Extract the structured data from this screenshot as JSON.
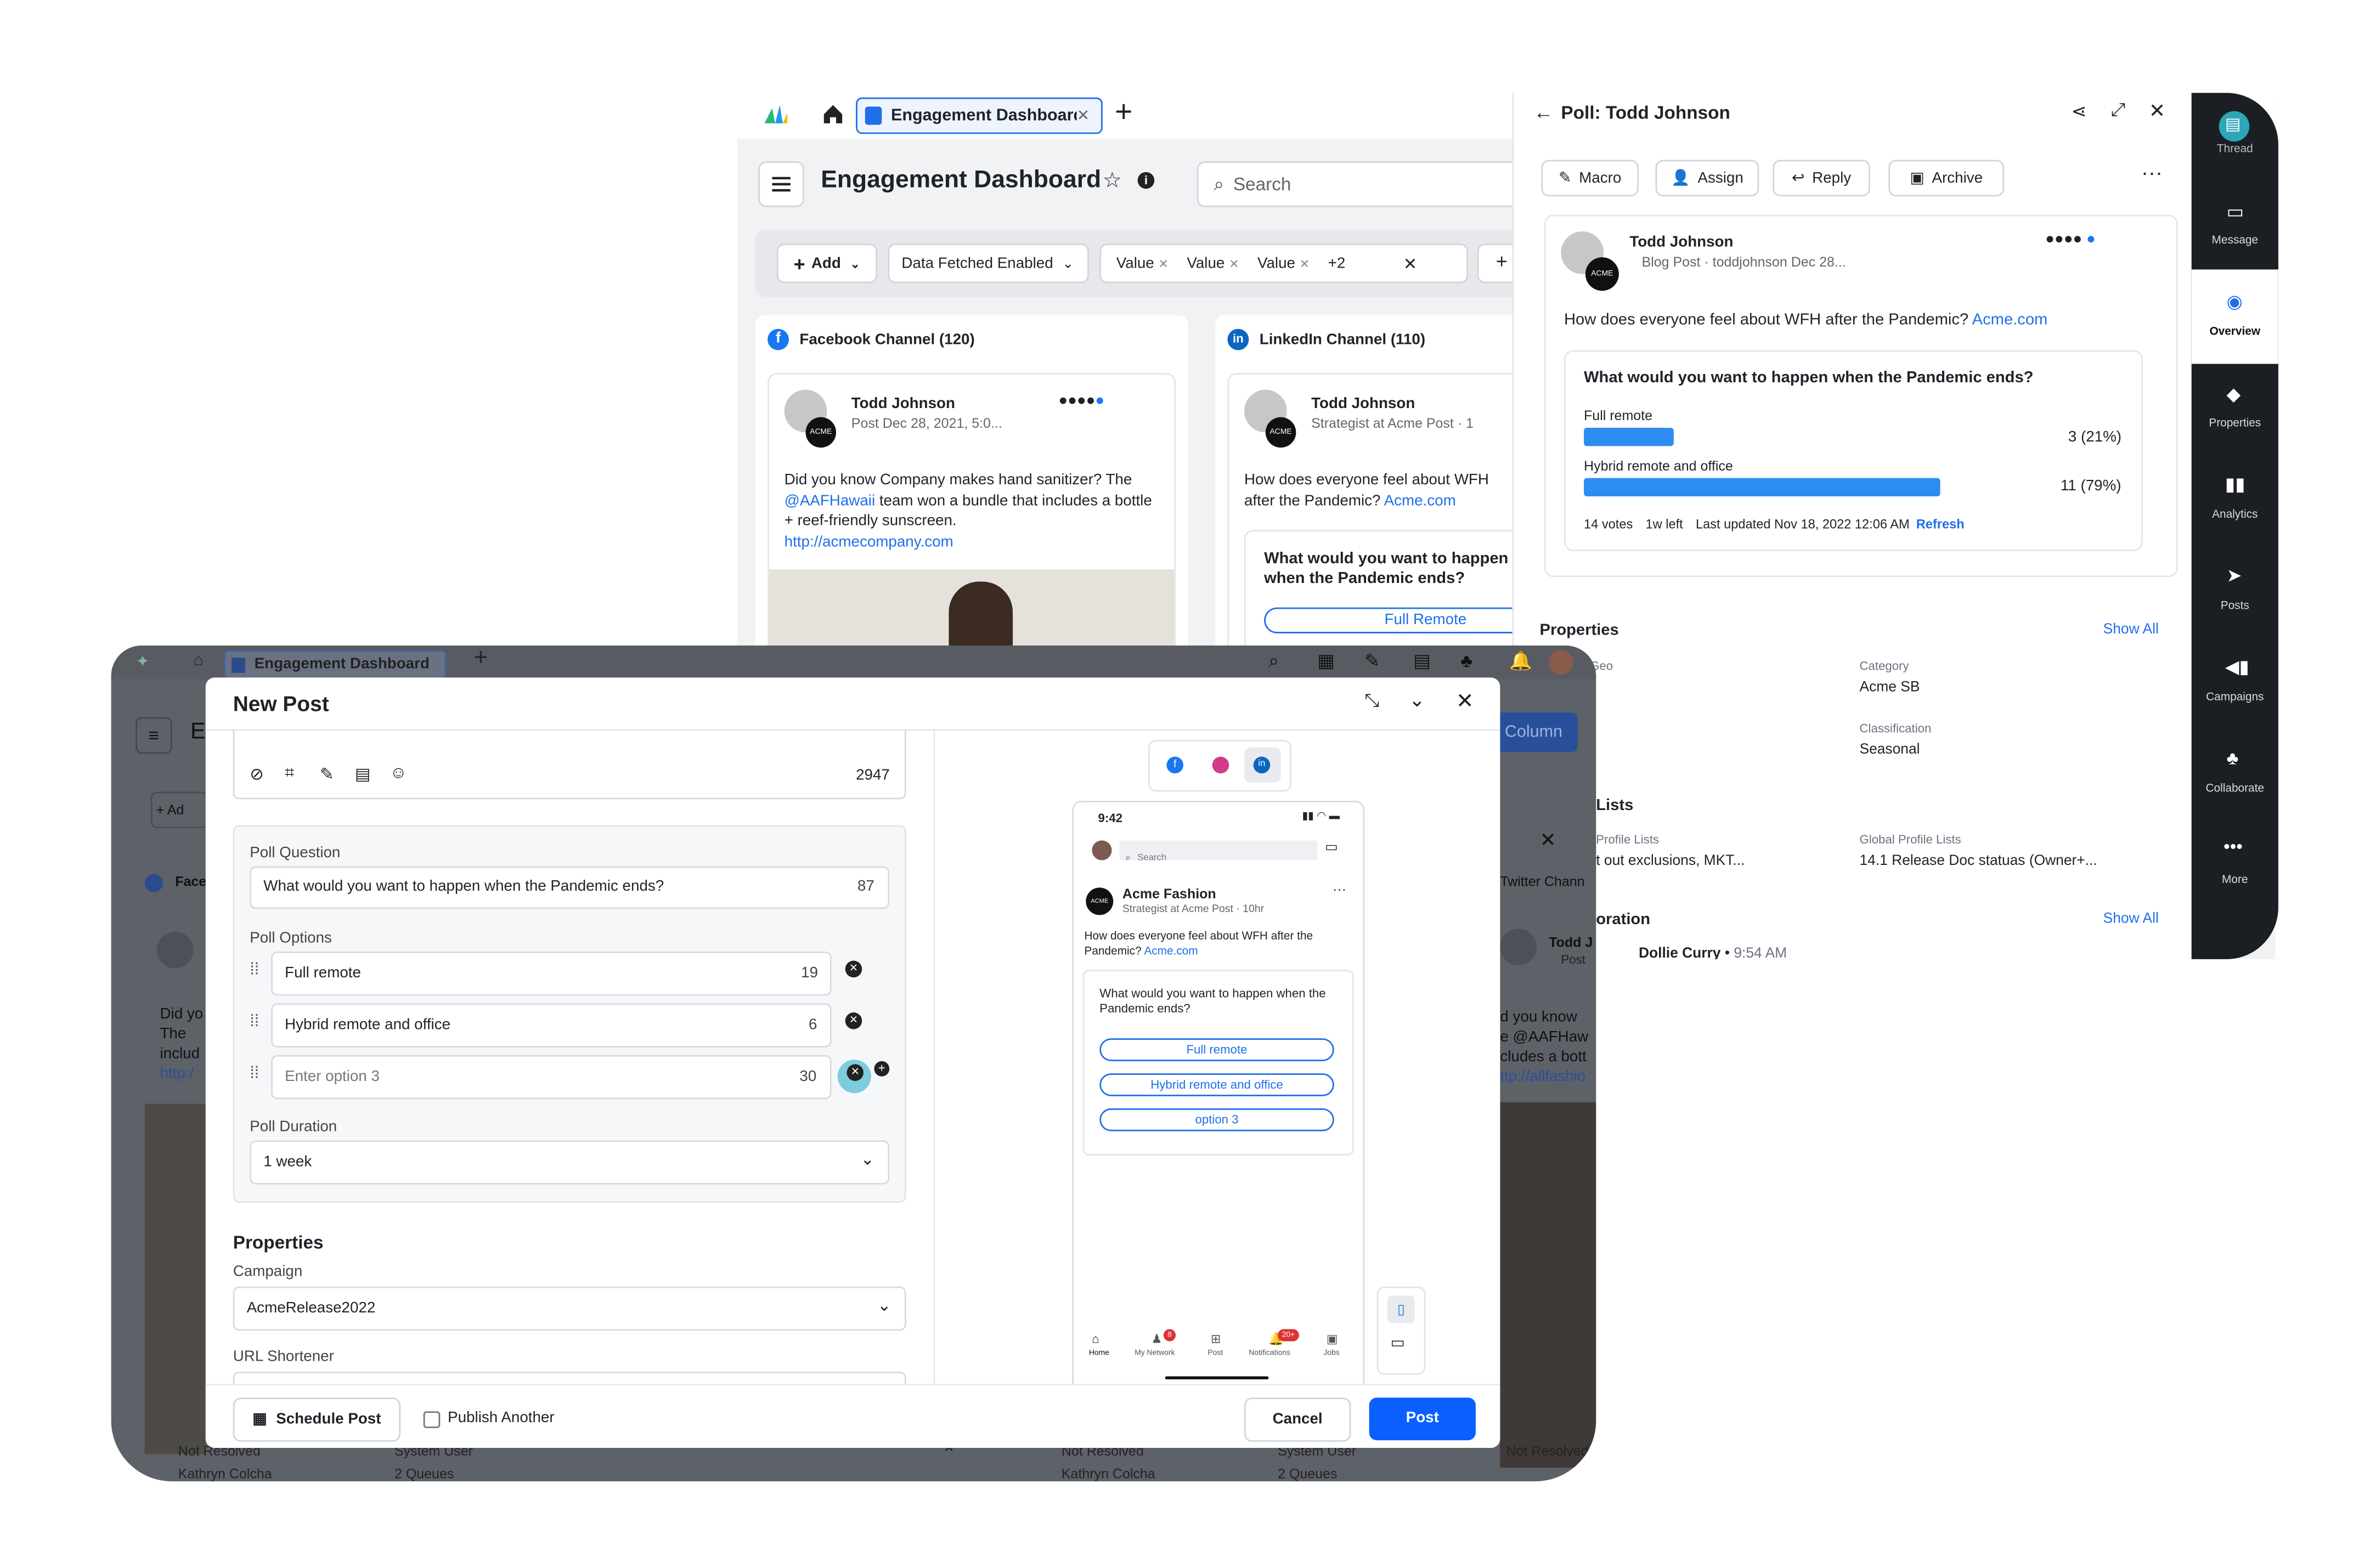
{
  "back_window": {
    "tab_title": "Engagement Dashboard",
    "page_title": "Engagement Dashboard",
    "search_placeholder": "Search",
    "filters": {
      "add_label": "Add",
      "data_fetched": "Data Fetched Enabled",
      "chips": [
        "Value",
        "Value",
        "Value"
      ],
      "more_chip": "+2"
    },
    "columns": [
      {
        "title": "Facebook Channel (120)"
      },
      {
        "title": "LinkedIn Channel (110)"
      }
    ],
    "fb_post": {
      "author": "Todd Johnson",
      "meta": "Post  Dec 28, 2021, 5:0...",
      "text_a": "Did you know Company makes hand sanitizer? The ",
      "mention": "@AAFHawaii",
      "text_b": " team won a bundle that includes a bottle + reef-friendly sunscreen.",
      "link": "http://acmecompany.com"
    },
    "li_post": {
      "author": "Todd Johnson",
      "meta": "Strategist at Acme  Post · 1",
      "text": "How does everyone feel about WFH after the Pandemic?",
      "link": "Acme.com",
      "poll_question": "What would you want to happen when the Pandemic ends?",
      "option": "Full Remote"
    }
  },
  "poll_panel": {
    "title": "Poll: Todd Johnson",
    "actions": [
      "Macro",
      "Assign",
      "Reply",
      "Archive"
    ],
    "author": "Todd Johnson",
    "meta": "Blog Post · toddjohnson Dec 28...",
    "text": "How does everyone feel about WFH after the Pandemic?",
    "link": "Acme.com",
    "question": "What would you want to happen when the Pandemic ends?",
    "options": [
      {
        "label": "Full remote",
        "result": "3 (21%)",
        "percent": 21
      },
      {
        "label": "Hybrid remote and office",
        "result": "11 (79%)",
        "percent": 79
      }
    ],
    "votes": "14 votes",
    "time_left": "1w left",
    "updated": "Last updated Nov 18, 2022 12:06 AM",
    "refresh": "Refresh",
    "properties_title": "Properties",
    "show_all": "Show All",
    "geo_label": "Geo",
    "category_label": "Category",
    "category_value": "Acme SB",
    "classification_label": "Classification",
    "classification_value": "Seasonal",
    "lists_title": "Lists",
    "profile_lists_label": "Profile Lists",
    "profile_lists_value": "t out exclusions, MKT...",
    "global_lists_label": "Global Profile Lists",
    "global_lists_value": "14.1 Release Doc statuas (Owner+...",
    "collab_title": "oration",
    "collab_person": "Dollie Curry",
    "collab_time": "9:54 AM"
  },
  "right_rail": [
    {
      "label": "Thread"
    },
    {
      "label": "Message"
    },
    {
      "label": "Overview"
    },
    {
      "label": "Properties"
    },
    {
      "label": "Analytics"
    },
    {
      "label": "Posts"
    },
    {
      "label": "Campaigns"
    },
    {
      "label": "Collaborate"
    },
    {
      "label": "More"
    }
  ],
  "front_window": {
    "tab_title": "Engagement Dashboard",
    "column_button": "Column",
    "bg_left_col": {
      "title": "Face",
      "add": "Ad",
      "text": [
        "Did yo",
        "The ",
        "includ",
        "http:/"
      ],
      "e_letter": "E"
    },
    "bg_right_col": {
      "title": "Twitter Chann",
      "author": "Todd J",
      "meta": "Post",
      "text": [
        "d you know ",
        "e @AAFHaw",
        "cludes a bott",
        "ttp://allfashio"
      ]
    },
    "bottom_status": {
      "not_resolved": "Not Resolved",
      "system_user": "System User",
      "kathryn": "Kathryn Colcha",
      "queues": "2 Queues"
    }
  },
  "new_post": {
    "title": "New Post",
    "char_count": "2947",
    "poll_question_label": "Poll Question",
    "poll_question_value": "What would you want to happen when the Pandemic ends?",
    "poll_question_count": "87",
    "poll_options_label": "Poll Options",
    "options": [
      {
        "value": "Full remote",
        "count": "19"
      },
      {
        "value": "Hybrid remote and office",
        "count": "6"
      }
    ],
    "option3_placeholder": "Enter option 3",
    "option3_count": "30",
    "duration_label": "Poll Duration",
    "duration_value": "1 week",
    "properties_title": "Properties",
    "campaign_label": "Campaign",
    "campaign_value": "AcmeRelease2022",
    "url_shortener_label": "URL Shortener",
    "schedule_btn": "Schedule Post",
    "publish_another": "Publish Another",
    "cancel_btn": "Cancel",
    "post_btn": "Post",
    "preview": {
      "time": "9:42",
      "search": "Search",
      "author": "Acme Fashion",
      "meta": "Strategist at Acme  Post · 10hr",
      "text": "How does everyone feel about WFH after the Pandemic?",
      "link": "Acme.com",
      "question": "What would you want to happen when the Pandemic ends?",
      "options": [
        "Full remote",
        "Hybrid remote and office",
        "option 3"
      ],
      "nav": [
        "Home",
        "My Network",
        "Post",
        "Notifications",
        "Jobs"
      ],
      "badge_network": "8",
      "badge_notif": "20+"
    }
  },
  "colors": {
    "accent": "#1f6feb",
    "rail_bg": "#1b1f24",
    "overlay": "#5d6168",
    "bar": "#2d8cf0"
  }
}
